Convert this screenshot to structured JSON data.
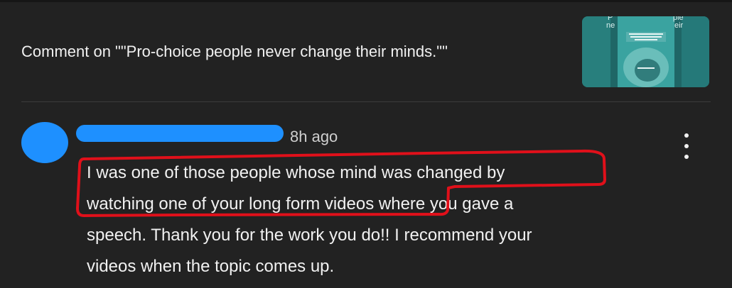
{
  "header": {
    "title": "Comment on \"\"Pro-choice people never change their minds.\"\""
  },
  "thumbnail": {
    "overlay_text_left": "ne",
    "overlay_text_right": "eir",
    "top_text_left": "P",
    "top_text_right": "ple"
  },
  "comment": {
    "timestamp": "8h ago",
    "lines": [
      "I was one of those people whose mind was changed by",
      "watching one of your long form videos where you gave a",
      "speech. Thank you for the work you do!! I recommend your",
      "videos when the topic comes up."
    ]
  },
  "colors": {
    "background": "#222222",
    "redaction_blue": "#1e90ff",
    "annotation_red": "#e0101a",
    "text": "#f1f1f1",
    "muted_text": "#cfcfcf"
  },
  "icons": {
    "menu": "more-vert-icon"
  }
}
